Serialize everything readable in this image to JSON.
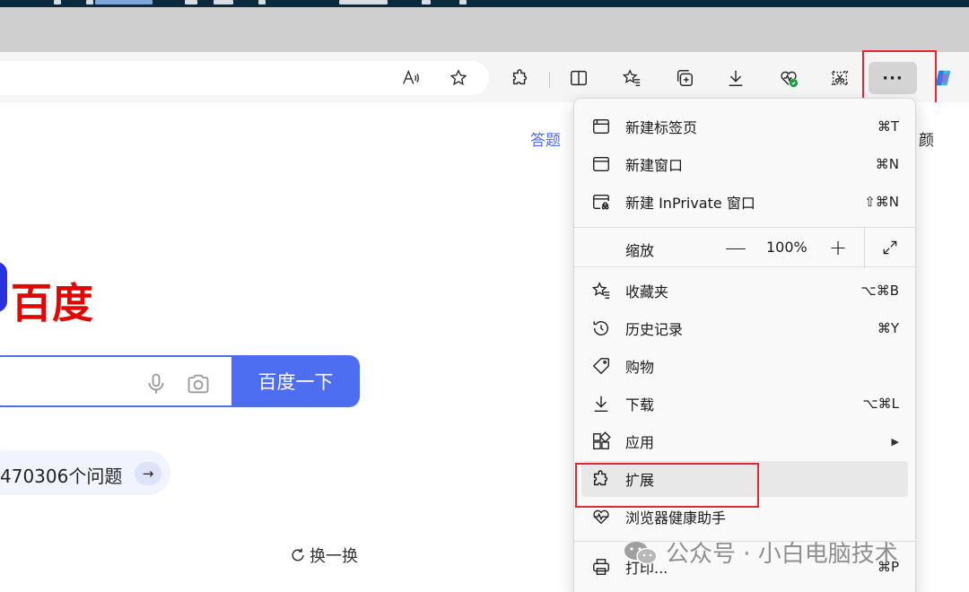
{
  "toolbar": {
    "icons": [
      "read-aloud-icon",
      "favorite-star-icon",
      "extensions-icon",
      "split-screen-icon",
      "favorites-icon",
      "collections-icon",
      "downloads-icon",
      "browser-essentials-icon",
      "screenshot-icon",
      "more-icon",
      "copilot-icon"
    ],
    "more_label": "···"
  },
  "page": {
    "top_link_1": "答题",
    "top_link_2": "颜",
    "logo_text": "百度",
    "search_button": "百度一下",
    "hot_text": "470306个问题",
    "hot_arrow": "→",
    "refresh": "换一换"
  },
  "menu": {
    "items": [
      {
        "label": "新建标签页",
        "shortcut": "⌘T",
        "icon": "new-tab-icon"
      },
      {
        "label": "新建窗口",
        "shortcut": "⌘N",
        "icon": "new-window-icon"
      },
      {
        "label": "新建 InPrivate 窗口",
        "shortcut": "⇧⌘N",
        "icon": "inprivate-icon"
      },
      {
        "label": "收藏夹",
        "shortcut": "⌥⌘B",
        "icon": "favorites-icon"
      },
      {
        "label": "历史记录",
        "shortcut": "⌘Y",
        "icon": "history-icon"
      },
      {
        "label": "购物",
        "shortcut": "",
        "icon": "shopping-tag-icon"
      },
      {
        "label": "下载",
        "shortcut": "⌥⌘L",
        "icon": "download-icon"
      },
      {
        "label": "应用",
        "shortcut": "▶",
        "icon": "apps-icon"
      },
      {
        "label": "扩展",
        "shortcut": "",
        "icon": "extensions-icon"
      },
      {
        "label": "浏览器健康助手",
        "shortcut": "",
        "icon": "health-icon"
      },
      {
        "label": "打印...",
        "shortcut": "⌘P",
        "icon": "print-icon"
      }
    ],
    "zoom": {
      "label": "缩放",
      "minus": "—",
      "value": "100%",
      "plus": "+"
    }
  },
  "watermark": "公众号 · 小白电脑技术",
  "colors": {
    "accent": "#4e6ef2",
    "logo_red": "#e10601",
    "highlight_box": "#e8262d"
  }
}
